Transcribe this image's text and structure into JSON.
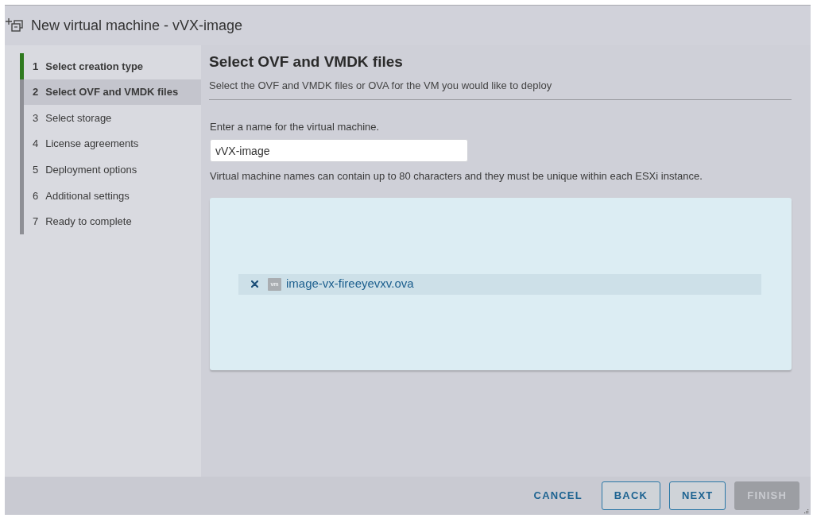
{
  "window": {
    "title": "New virtual machine - vVX-image"
  },
  "steps": [
    {
      "number": "1",
      "label": "Select creation type",
      "completed": true,
      "selected": false
    },
    {
      "number": "2",
      "label": "Select OVF and VMDK files",
      "completed": false,
      "selected": true
    },
    {
      "number": "3",
      "label": "Select storage",
      "completed": false,
      "selected": false
    },
    {
      "number": "4",
      "label": "License agreements",
      "completed": false,
      "selected": false
    },
    {
      "number": "5",
      "label": "Deployment options",
      "completed": false,
      "selected": false
    },
    {
      "number": "6",
      "label": "Additional settings",
      "completed": false,
      "selected": false
    },
    {
      "number": "7",
      "label": "Ready to complete",
      "completed": false,
      "selected": false
    }
  ],
  "page": {
    "heading": "Select OVF and VMDK files",
    "description": "Select the OVF and VMDK files or OVA for the VM you would like to deploy",
    "name_field": {
      "label": "Enter a name for the virtual machine.",
      "value": "vVX-image"
    },
    "help": "Virtual machine names can contain up to 80 characters and they must be unique within each ESXi instance."
  },
  "drop_zone": {
    "files": [
      {
        "type_label": "vm",
        "name": "image-vx-fireeyevxv.ova"
      }
    ]
  },
  "buttons": [
    {
      "label": "CANCEL",
      "kind": "flat",
      "disabled": false
    },
    {
      "label": "BACK",
      "kind": "outline",
      "disabled": false
    },
    {
      "label": "NEXT",
      "kind": "outline",
      "disabled": false
    },
    {
      "label": "FINISH",
      "kind": "primary",
      "disabled": true
    }
  ]
}
